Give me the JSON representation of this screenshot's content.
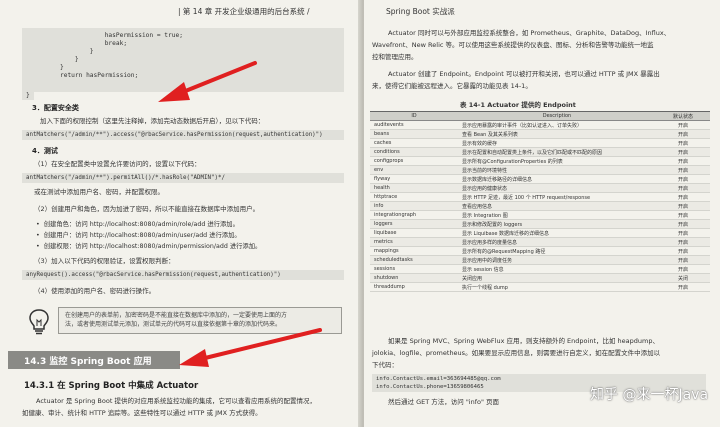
{
  "left_page": {
    "header": "| 第 14 章  开发企业级通用的后台系统 /",
    "code_top": [
      "            hasPermission = true;",
      "            break;",
      "        }",
      "    }",
      "}",
      "return hasPermission;"
    ],
    "code_end": "}",
    "h_security": "3．配置安全类",
    "p_security": "加入下面的权限控制（这里先注释掉，添加完动态数据后开启），见以下代码：",
    "code_access": "antMatchers(\"/admin/**\").access(\"@rbacService.hasPermission(request,authentication)\")",
    "h_test": "4．测试",
    "p_test1": "（1）在安全配置类中设置允许要访问的，设置以下代码：",
    "code_role": "antMatchers(\"/admin/**\").permitAll()/*.hasRole(\"ADMIN\")*/",
    "p_test2": "或在测试中添加用户名、密码，并配置权限。",
    "p_test3": "（2）创建用户和角色，因为加进了密码，所以不能直接在数据库中添加用户。",
    "bullets": [
      "创建角色：访问 http://localhost:8080/admin/role/add 进行添加。",
      "创建用户：访问 http://localhost:8080/admin/user/add 进行添加。",
      "创建权限：访问 http://localhost:8080/admin/permission/add 进行添加。"
    ],
    "p_test4": "（3）加入以下代码的权限验证，设置权限判断：",
    "code_any": "anyRequest().access(\"@rbacService.hasPermission(request,authentication)\")",
    "p_test5": "（4）使用添加的用户名、密码进行操作。",
    "tip_line1": "在创建用户的表单前，加密密码是不能直接在数据库中添加的，一定要使用上面的方",
    "tip_line2": "法，或者使用测试单元添加，测试单元的代码可以直接依据第十章的添加代码来。",
    "section_title": "14.3  监控 Spring Boot 应用",
    "subsection_title": "14.3.1  在 Spring Boot 中集成 Actuator",
    "p_actuator1": "Actuator 是 Spring Boot 提供的对应用系统监控功能的集成，它可以查看应用系统的配置情况，",
    "p_actuator2": "如健康、审计、统计和 HTTP 追踪等。这些特性可以通过 HTTP 或 JMX 方式获得。"
  },
  "right_page": {
    "header": "Spring Boot 实战派",
    "intro1": "Actuator 同时可以与外部应用监控系统整合，如 Prometheus、Graphite、DataDog、Influx、",
    "intro2": "Wavefront、New Relic 等。可以使用这些系统提供的仪表盘、图标、分析和告警等功能统一地监",
    "intro3": "控和管理应用。",
    "intro4": "Actuator 创建了 Endpoint。Endpoint 可以被打开和关闭，也可以通过 HTTP 或 JMX 暴露出",
    "intro5": "来，使得它们能被远程进入。它暴露的功能见表 14-1。",
    "table_caption": "表 14-1  Actuator 提供的 Endpoint",
    "table_headers": [
      "ID",
      "Description",
      "默认状态"
    ],
    "rows": [
      [
        "auditevents",
        "显示应用暴露的审计事件（比如认证进入、订单失败）",
        "开启"
      ],
      [
        "beans",
        "查看 Bean 及其关系列表",
        "开启"
      ],
      [
        "caches",
        "显示有效的缓存",
        "开启"
      ],
      [
        "conditions",
        "显示在配置和自动配置类上条件，以及它们匹配或不匹配的原因",
        "开启"
      ],
      [
        "configprops",
        "显示所有@ConfigurationProperties 的列表",
        "开启"
      ],
      [
        "env",
        "显示当前的环境特性",
        "开启"
      ],
      [
        "flyway",
        "显示数据库迁移路径的详细信息",
        "开启"
      ],
      [
        "health",
        "显示应用的健康状态",
        "开启"
      ],
      [
        "httptrace",
        "显示 HTTP 足迹，最近 100 个 HTTP request/response",
        "开启"
      ],
      [
        "info",
        "查看应用信息",
        "开启"
      ],
      [
        "integrationgraph",
        "显示 Integration 图",
        "开启"
      ],
      [
        "loggers",
        "显示和修改配置的 loggers",
        "开启"
      ],
      [
        "liquibase",
        "显示 Liquibase 数据库迁移的详细信息",
        "开启"
      ],
      [
        "metrics",
        "显示应用多样的度量信息",
        "开启"
      ],
      [
        "mappings",
        "显示所有的@RequestMapping 路径",
        "开启"
      ],
      [
        "scheduledtasks",
        "显示应用中的调度任务",
        "开启"
      ],
      [
        "sessions",
        "显示 session 信息",
        "开启"
      ],
      [
        "shutdown",
        "关闭应用",
        "关闭"
      ],
      [
        "threaddump",
        "执行一个线程 dump",
        "开启"
      ]
    ],
    "after1": "如果是 Spring MVC、Spring WebFlux 应用，则支持额外的 Endpoint，比如 heapdump、",
    "after2": "jolokia、logfile、prometheus。如果要显示应用信息，则需要进行自定义，如在配置文件中添加以",
    "after3": "下代码：",
    "code_info1": "info.ContactUs.email=363694485@qq.com",
    "code_info2": "info.ContactUs.phone=13659806465",
    "last_line": "然后通过 GET 方法，访问 \"info\" 页面"
  },
  "watermark": "知乎 @来一杯Java"
}
